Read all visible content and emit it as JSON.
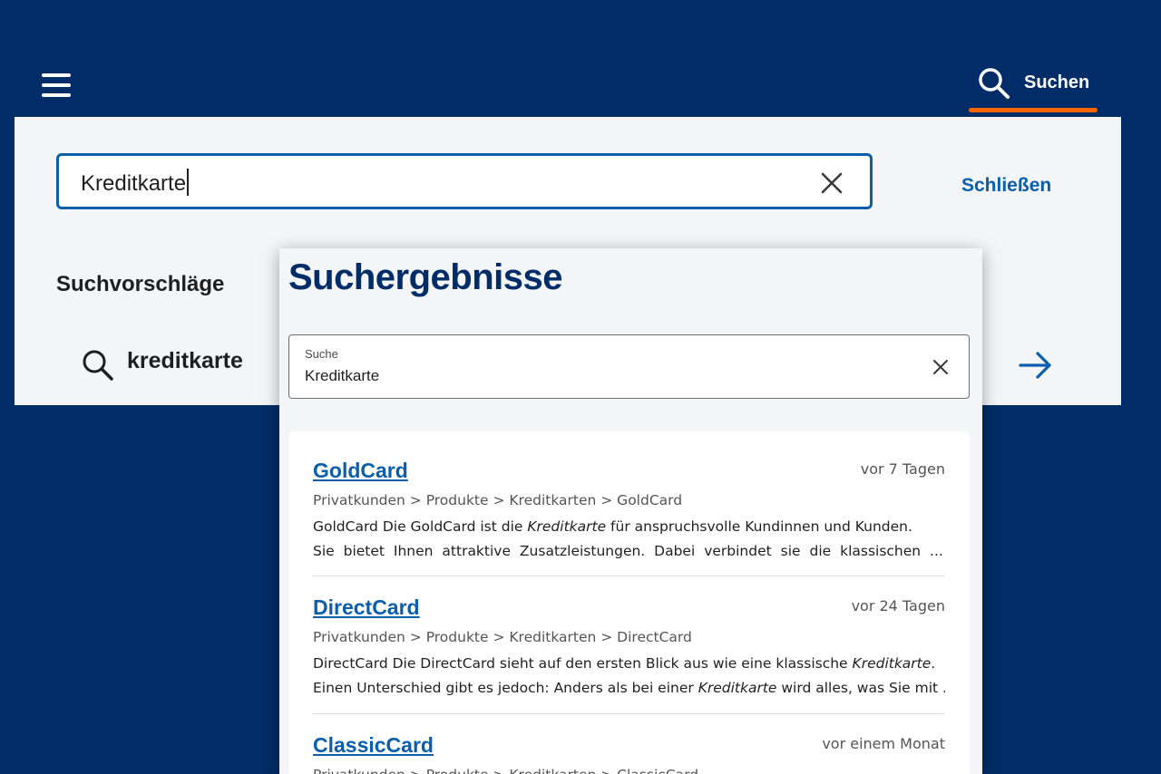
{
  "header": {
    "search_label": "Suchen",
    "accent_color": "#ff6400",
    "background_color": "#002d67"
  },
  "search_panel": {
    "query": "Kreditkarte",
    "close_label": "Schließen",
    "suggestions_title": "Suchvorschläge",
    "suggestions": [
      {
        "text": "kreditkarte"
      }
    ]
  },
  "results_panel": {
    "title": "Suchergebnisse",
    "search_field_label": "Suche",
    "search_value": "Kreditkarte",
    "results": [
      {
        "title": "GoldCard",
        "age": "vor 7 Tagen",
        "breadcrumb": "Privatkunden > Produkte > Kreditkarten > GoldCard",
        "snippet_line1_a": "GoldCard Die GoldCard ist die ",
        "snippet_line1_em": "Kreditkarte",
        "snippet_line1_b": " für anspruchsvolle Kundinnen und Kunden.",
        "snippet_line2_a": "Sie bietet Ihnen attraktive Zusatzleistungen. Dabei verbindet sie die klassischen ...",
        "snippet_line2_em": "",
        "snippet_line2_b": ""
      },
      {
        "title": "DirectCard",
        "age": "vor 24 Tagen",
        "breadcrumb": "Privatkunden > Produkte > Kreditkarten > DirectCard",
        "snippet_line1_a": "DirectCard Die DirectCard sieht auf den ersten Blick aus wie eine klassische ",
        "snippet_line1_em": "Kreditkarte",
        "snippet_line1_b": ".",
        "snippet_line2_a": "Einen Unterschied gibt es jedoch: Anders als bei einer ",
        "snippet_line2_em": "Kreditkarte",
        "snippet_line2_b": " wird alles, was Sie mit ..."
      },
      {
        "title": "ClassicCard",
        "age": "vor einem Monat",
        "breadcrumb": "Privatkunden > Produkte > Kreditkarten > ClassicCard",
        "snippet_line1_a": "",
        "snippet_line1_em": "",
        "snippet_line1_b": "",
        "snippet_line2_a": "",
        "snippet_line2_em": "",
        "snippet_line2_b": ""
      }
    ]
  },
  "icons": {
    "menu": "hamburger-menu-icon",
    "search": "search-icon",
    "clear": "close-icon",
    "go": "arrow-right-icon"
  }
}
